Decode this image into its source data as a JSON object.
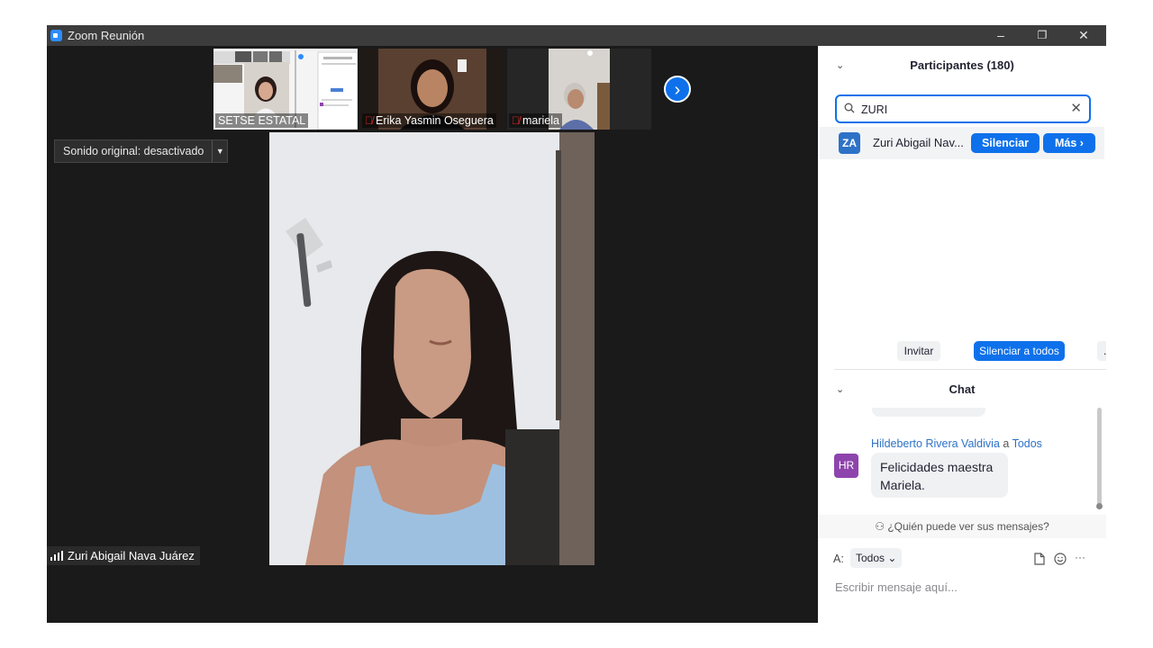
{
  "window": {
    "title": "Zoom Reunión",
    "minimize_glyph": "–",
    "restore_glyph": "❐",
    "close_glyph": "✕"
  },
  "thumbnails": [
    {
      "label": "SETSE ESTATAL",
      "muted": false
    },
    {
      "label": "Erika Yasmin Oseguera",
      "muted": true
    },
    {
      "label": "mariela",
      "muted": true
    }
  ],
  "stage": {
    "next_glyph": "›",
    "sound_label": "Sonido original: desactivado",
    "dropdown_glyph": "▼",
    "active_speaker": "Zuri Abigail Nava Juárez"
  },
  "participants": {
    "header": "Participantes (180)",
    "collapse_glyph": "⌄",
    "search_value": "ZURI",
    "clear_glyph": "✕",
    "results": [
      {
        "initials": "ZA",
        "name": "Zuri Abigail Nav...",
        "mute_label": "Silenciar",
        "more_label": "Más ›",
        "avatar_color": "#2d72c7"
      }
    ],
    "invite_label": "Invitar",
    "mute_all_label": "Silenciar a todos",
    "more_label": "..."
  },
  "chat": {
    "header": "Chat",
    "collapse_glyph": "⌄",
    "messages": [
      {
        "initials": "HR",
        "sender": "Hildeberto Rivera Valdivia",
        "to_word": "a",
        "recipient": "Todos",
        "text": "Felicidades maestra Mariela.",
        "avatar_color": "#8e44ad"
      }
    ],
    "who_can_see": "¿Quién puede ver sus mensajes?",
    "to_label": "A:",
    "to_value": "Todos ⌄",
    "placeholder": "Escribir mensaje aquí...",
    "more_glyph": "···"
  },
  "colors": {
    "accent": "#0e71eb",
    "mic_muted": "#e02828",
    "stage_bg": "#1a1a1a"
  }
}
